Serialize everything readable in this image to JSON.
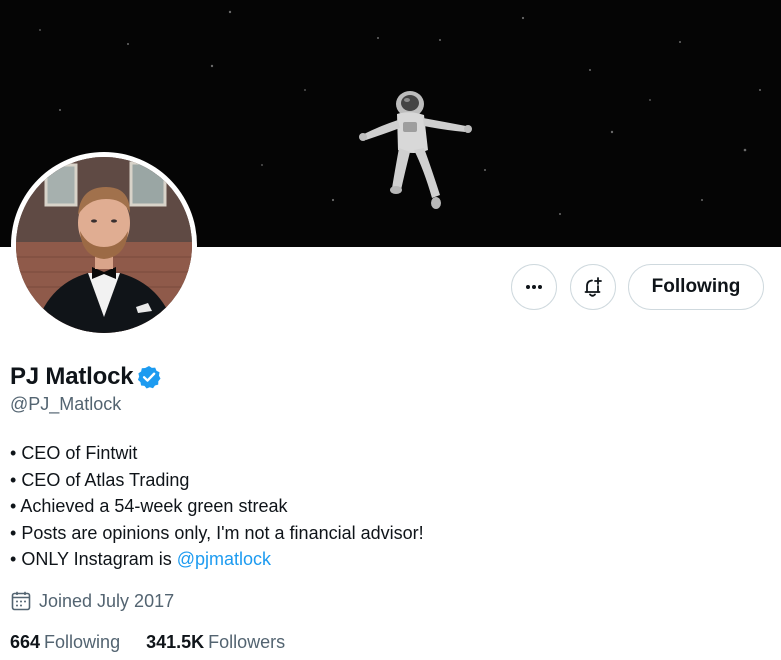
{
  "profile": {
    "display_name": "PJ Matlock",
    "handle": "@PJ_Matlock",
    "verified": true,
    "bio": [
      {
        "prefix": "• ",
        "text": "CEO of Fintwit"
      },
      {
        "prefix": "• ",
        "text": "CEO of Atlas Trading"
      },
      {
        "prefix": "• ",
        "text": "Achieved a 54-week green streak"
      },
      {
        "prefix": "• ",
        "text": "Posts are opinions only, I'm not a financial advisor!"
      }
    ],
    "bio_last": {
      "prefix": "• ",
      "text": "ONLY Instagram is ",
      "mention": "@pjmatlock"
    },
    "joined": "Joined July 2017",
    "following_count": "664",
    "following_label": "Following",
    "followers_count": "341.5K",
    "followers_label": "Followers"
  },
  "actions": {
    "more_icon": "more-horizontal-icon",
    "notify_icon": "bell-plus-icon",
    "following_button_label": "Following"
  },
  "banner": {
    "description_icon": "astronaut-in-space"
  },
  "colors": {
    "accent": "#1d9bf0",
    "text_primary": "#0f1419",
    "text_secondary": "#536471",
    "border": "#cfd9de"
  }
}
